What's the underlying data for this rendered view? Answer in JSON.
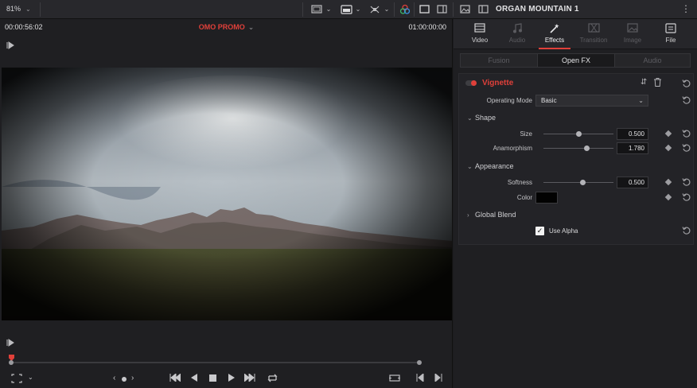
{
  "topbar": {
    "zoom": "81%",
    "clip_title": "ORGAN MOUNTAIN 1"
  },
  "viewer": {
    "timecode_left": "00:00:56:02",
    "timeline_name": "OMO PROMO",
    "timecode_right": "01:00:00:00"
  },
  "inspector": {
    "tabs": [
      {
        "label": "Video",
        "icon": "video-icon",
        "state": "normal"
      },
      {
        "label": "Audio",
        "icon": "music-icon",
        "state": "dim"
      },
      {
        "label": "Effects",
        "icon": "magic-wand-icon",
        "state": "active"
      },
      {
        "label": "Transition",
        "icon": "transition-icon",
        "state": "dim"
      },
      {
        "label": "Image",
        "icon": "image-icon",
        "state": "dim"
      },
      {
        "label": "File",
        "icon": "file-icon",
        "state": "normal"
      }
    ],
    "sub_tabs": [
      {
        "label": "Fusion",
        "state": "dim"
      },
      {
        "label": "Open FX",
        "state": "active"
      },
      {
        "label": "Audio",
        "state": "dim"
      }
    ],
    "effect": {
      "name": "Vignette",
      "enabled": true,
      "operating_mode_label": "Operating Mode",
      "operating_mode_value": "Basic",
      "groups": {
        "shape": "Shape",
        "appearance": "Appearance",
        "global_blend": "Global Blend"
      },
      "params": {
        "size": {
          "label": "Size",
          "value": "0.500",
          "fraction": 0.5
        },
        "anamorphism": {
          "label": "Anamorphism",
          "value": "1.780",
          "fraction": 0.62
        },
        "softness": {
          "label": "Softness",
          "value": "0.500",
          "fraction": 0.56
        }
      },
      "color_label": "Color",
      "color_value": "#020202",
      "use_alpha_label": "Use Alpha",
      "use_alpha_checked": true
    },
    "accent_color": "#e0403a"
  },
  "scrubber": {
    "position": 0.0
  }
}
